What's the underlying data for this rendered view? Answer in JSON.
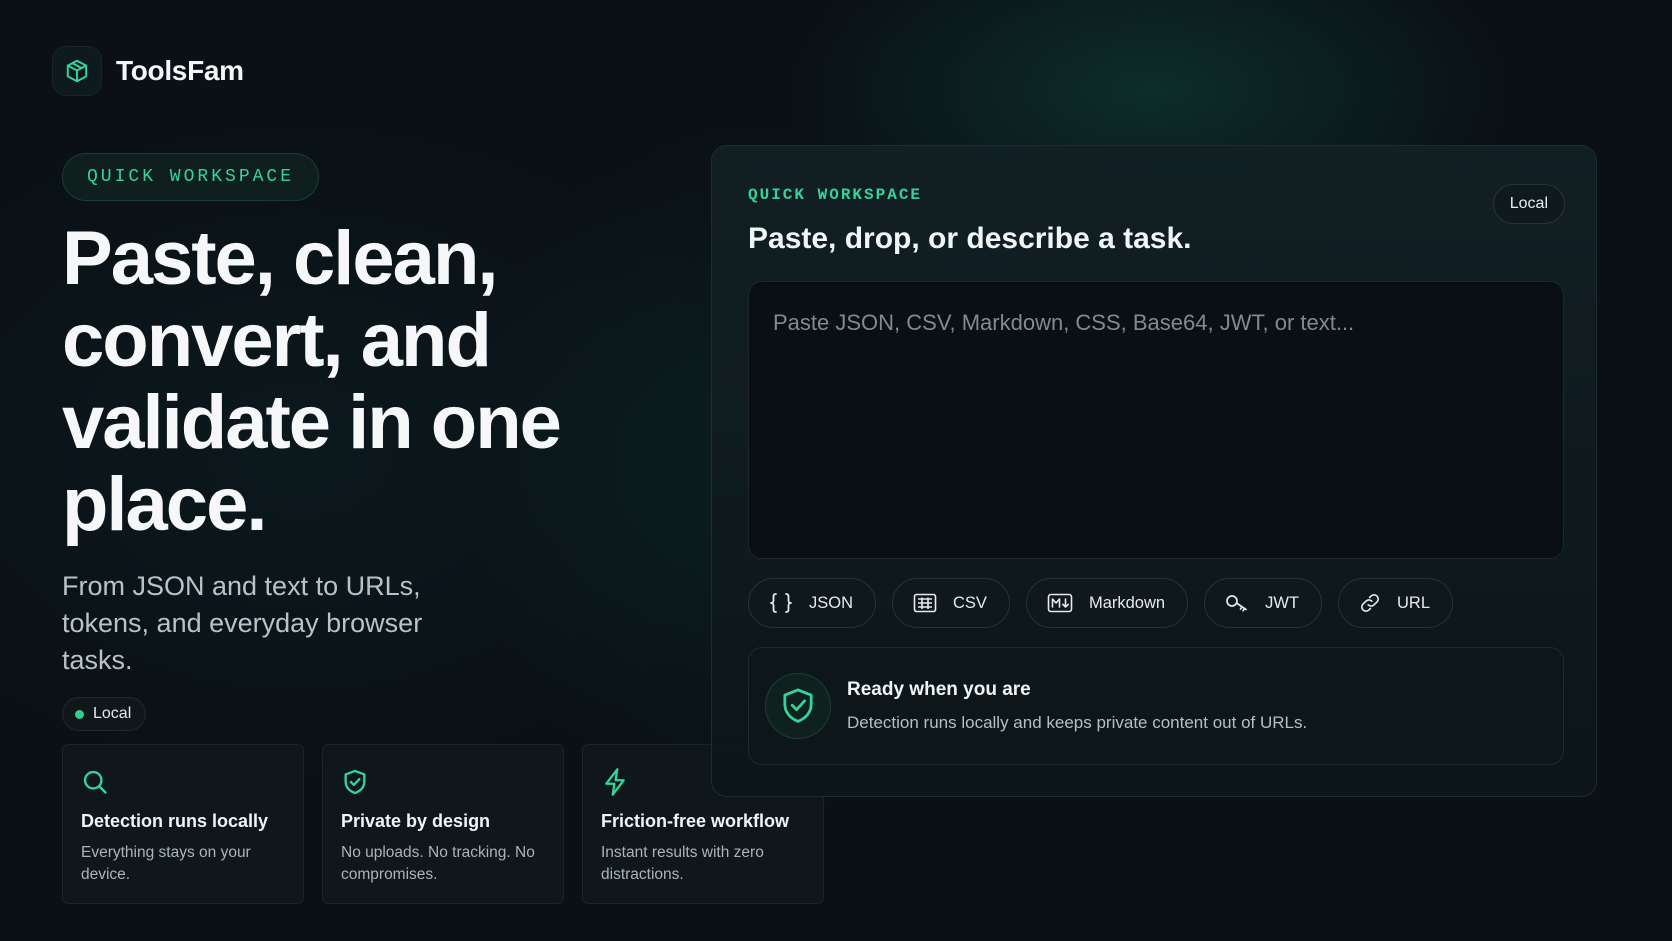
{
  "brand": {
    "name": "ToolsFam",
    "logo_icon": "cube-icon"
  },
  "hero": {
    "eyebrow": "QUICK WORKSPACE",
    "title": "Paste, clean, convert, and validate in one place.",
    "subtitle": "From JSON and text to URLs, tokens, and everyday browser tasks.",
    "local_chip": "Local"
  },
  "features": [
    {
      "icon": "search-icon",
      "title": "Detection runs locally",
      "body": "Everything stays on your device."
    },
    {
      "icon": "shield-check-icon",
      "title": "Private by design",
      "body": "No uploads. No tracking. No compromises."
    },
    {
      "icon": "bolt-icon",
      "title": "Friction-free workflow",
      "body": "Instant results with zero distractions."
    }
  ],
  "workspace": {
    "eyebrow": "QUICK WORKSPACE",
    "title": "Paste, drop, or describe a task.",
    "badge": "Local",
    "input_placeholder": "Paste JSON, CSV, Markdown, CSS, Base64, JWT, or text...",
    "input_value": "",
    "chips": [
      {
        "label": "JSON",
        "icon": "braces-icon"
      },
      {
        "label": "CSV",
        "icon": "table-icon"
      },
      {
        "label": "Markdown",
        "icon": "markdown-icon"
      },
      {
        "label": "JWT",
        "icon": "key-icon"
      },
      {
        "label": "URL",
        "icon": "link-icon"
      }
    ],
    "status": {
      "icon": "shield-check-icon",
      "title": "Ready when you are",
      "body": "Detection runs locally and keeps private content out of URLs."
    }
  },
  "colors": {
    "accent": "#35d39a",
    "background": "#0a1016",
    "card": "#0f171c"
  }
}
